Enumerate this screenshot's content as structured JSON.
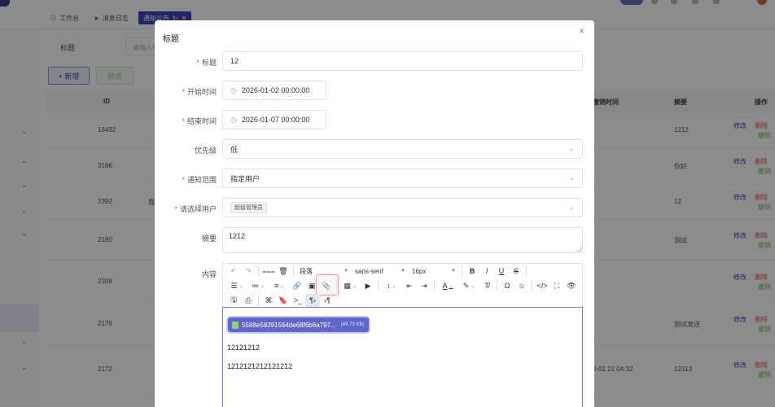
{
  "background": {
    "tabs": [
      {
        "label": "工作台",
        "icon": "user-icon"
      },
      {
        "label": "消息日志",
        "icon": "send-icon"
      },
      {
        "label": "通知公告",
        "icon": "refresh-icon",
        "active": true
      }
    ],
    "search": {
      "label": "标题",
      "placeholder": "请输入标题"
    },
    "buttons": {
      "add": "+ 新增",
      "edit": "修改"
    },
    "columns": {
      "id": "ID",
      "undo_time": "撤销时间",
      "summary": "摘要",
      "actions": "操作"
    },
    "rows": [
      {
        "id": "16492",
        "summary": "1212"
      },
      {
        "id": "3166",
        "summary": "你好"
      },
      {
        "id": "2392",
        "summary": "12",
        "extra": "我"
      },
      {
        "id": "2180",
        "summary": "测试"
      },
      {
        "id": "2208",
        "summary": ""
      },
      {
        "id": "2179",
        "summary": "测试发送"
      },
      {
        "id": "2172",
        "summary": "12313",
        "time": "0-01 21:04:32"
      }
    ],
    "row_actions": {
      "edit": "修改",
      "delete": "删除",
      "undo": "撤销"
    }
  },
  "modal": {
    "title": "标题",
    "close": "×",
    "fields": {
      "title": {
        "label": "标题",
        "value": "12"
      },
      "start": {
        "label": "开始时间",
        "value": "2026-01-02 00:00:00"
      },
      "end": {
        "label": "结束时间",
        "value": "2026-01-07 00:00:00"
      },
      "priority": {
        "label": "优先级",
        "value": "低"
      },
      "scope": {
        "label": "通知范围",
        "value": "指定用户"
      },
      "users": {
        "label": "请选择用户",
        "tag": "超级管理员"
      },
      "summary": {
        "label": "摘要",
        "value": "1212"
      },
      "content": {
        "label": "内容"
      }
    },
    "editor": {
      "block_format": "段落",
      "font_family": "sans-serif",
      "font_size": "16px",
      "file_name": "5588e58391564de68f6b6a797...",
      "file_size": "(49.73 KB)",
      "lines": [
        "12121212",
        "1212121212121212"
      ]
    }
  }
}
